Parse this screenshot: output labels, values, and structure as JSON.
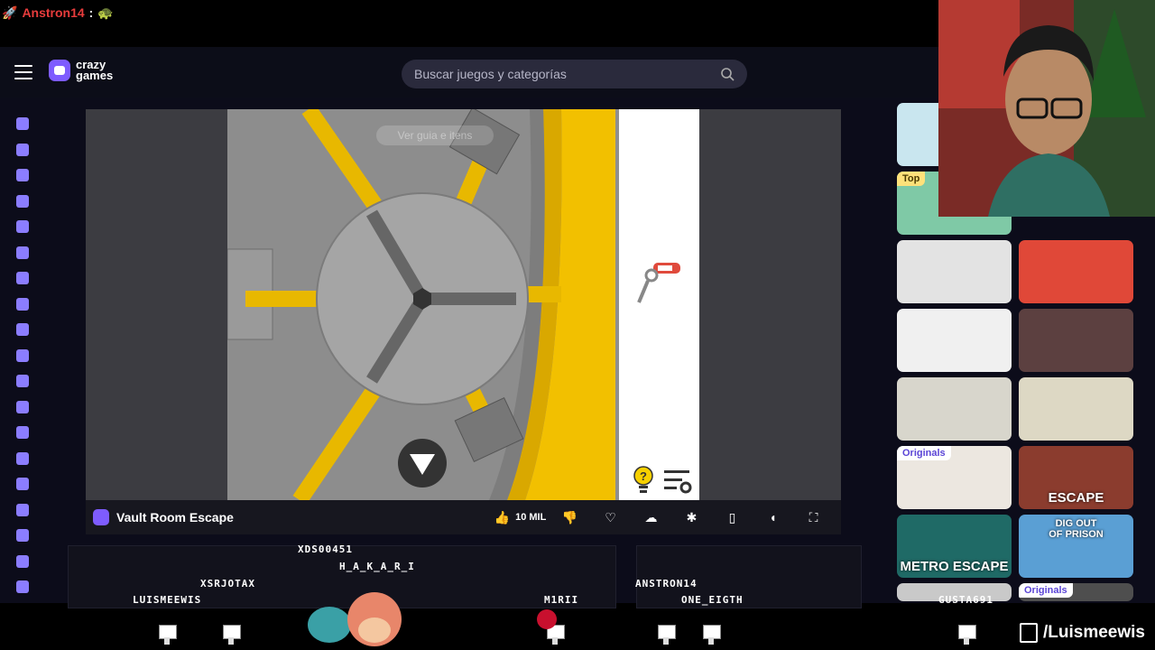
{
  "chat": {
    "username": "Anstron14",
    "separator": ":"
  },
  "header": {
    "logo_line1": "crazy",
    "logo_line2": "games",
    "search_placeholder": "Buscar juegos y categorías"
  },
  "sidebar_icons": [
    "home-icon",
    "clock-icon",
    "sparkle-icon",
    "fire-icon",
    "refresh-icon",
    "gamepad-icon",
    "users-icon",
    "bolt-icon",
    "compass-icon",
    "basketball-icon",
    "key-icon",
    "puzzle-icon",
    "figure-icon",
    "rocket-icon",
    "car-icon",
    "steering-icon",
    "controller-icon",
    "chess-icon",
    "tag-icon"
  ],
  "game": {
    "faded_text": "Ver guia e itens",
    "title": "Vault Room Escape",
    "likes": "10 MIL"
  },
  "thumbs": {
    "top_tag": "Top",
    "originals_tag": "Originals",
    "escape_label": "ESCAPE",
    "metro_label": "METRO ESCAPE",
    "prison_line1": "DIG OUT",
    "prison_line2": "OF PRISON",
    "originals_tag2": "Originals"
  },
  "overlay_names": [
    "XDS00451",
    "H_A_K_A_R_I",
    "XSRJOTAX",
    "LUISMEEWIS",
    "M1RII",
    "ANSTRON14",
    "ONE_EIGTH",
    "GUSTA691"
  ],
  "stream": {
    "handle": "/Luismeewis"
  },
  "colors": {
    "accent": "#7e5cff",
    "vault_yellow": "#f5c800",
    "chat_user": "#e83c3c"
  }
}
